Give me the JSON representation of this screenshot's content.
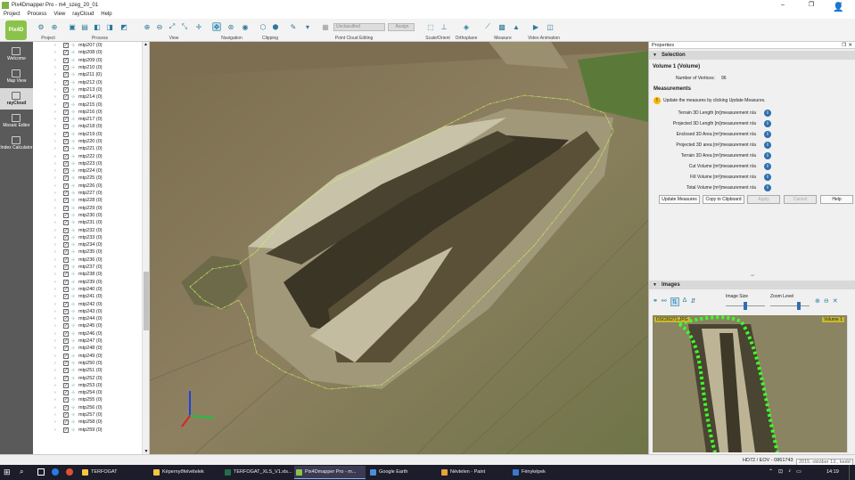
{
  "window": {
    "title": "Pix4Dmapper Pro - m4_szeg_20_01",
    "minimize": "–",
    "maximize": "❐",
    "close": "✕"
  },
  "menu": [
    "Project",
    "Process",
    "View",
    "rayCloud",
    "Help"
  ],
  "toolbar": {
    "groups": [
      "Project",
      "Process",
      "View",
      "Navigation",
      "Clipping",
      "Point Cloud Editing",
      "Scale/Orient",
      "Orthoplane",
      "Measure",
      "Video Animation"
    ],
    "class_combo": "Unclassified",
    "assign_label": "Assign"
  },
  "left_sidebar": {
    "logo": "Pix4D",
    "items": [
      {
        "label": "Welcome",
        "active": false
      },
      {
        "label": "Map View",
        "active": false
      },
      {
        "label": "rayCloud",
        "active": true
      },
      {
        "label": "Mosaic Editor",
        "active": false
      },
      {
        "label": "Index Calculator",
        "active": false
      }
    ]
  },
  "tree_items": [
    "mtp207 (0)",
    "mtp208 (0)",
    "mtp209 (0)",
    "mtp210 (0)",
    "mtp211 (0)",
    "mtp212 (0)",
    "mtp213 (0)",
    "mtp214 (0)",
    "mtp215 (0)",
    "mtp216 (0)",
    "mtp217 (0)",
    "mtp218 (0)",
    "mtp219 (0)",
    "mtp220 (0)",
    "mtp221 (0)",
    "mtp222 (0)",
    "mtp223 (0)",
    "mtp224 (0)",
    "mtp225 (0)",
    "mtp226 (0)",
    "mtp227 (0)",
    "mtp228 (0)",
    "mtp229 (0)",
    "mtp230 (0)",
    "mtp231 (0)",
    "mtp232 (0)",
    "mtp233 (0)",
    "mtp234 (0)",
    "mtp235 (0)",
    "mtp236 (0)",
    "mtp237 (0)",
    "mtp238 (0)",
    "mtp239 (0)",
    "mtp240 (0)",
    "mtp241 (0)",
    "mtp242 (0)",
    "mtp243 (0)",
    "mtp244 (0)",
    "mtp245 (0)",
    "mtp246 (0)",
    "mtp247 (0)",
    "mtp248 (0)",
    "mtp249 (0)",
    "mtp250 (0)",
    "mtp251 (0)",
    "mtp252 (0)",
    "mtp253 (0)",
    "mtp254 (0)",
    "mtp255 (0)",
    "mtp256 (0)",
    "mtp257 (0)",
    "mtp258 (0)",
    "mtp259 (0)"
  ],
  "properties": {
    "title": "Properties",
    "selection_header": "Selection",
    "volume_name": "Volume 1 (Volume)",
    "vertices_label": "Number of Vertices:",
    "vertices_value": "96",
    "measurements_header": "Measurements",
    "warning": "Update the measures by clicking Update Measures.",
    "measures": [
      {
        "label": "Terrain 3D Length [m]:",
        "value": "measurement n/a"
      },
      {
        "label": "Projected 3D Length [m]:",
        "value": "measurement n/a"
      },
      {
        "label": "Enclosed 3D Area [m²]:",
        "value": "measurement n/a"
      },
      {
        "label": "Projected 3D area [m²]:",
        "value": "measurement n/a"
      },
      {
        "label": "Terrain 3D Area [m²]:",
        "value": "measurement n/a"
      },
      {
        "label": "Cut Volume [m³]:",
        "value": "measurement n/a"
      },
      {
        "label": "Fill Volume [m³]:",
        "value": "measurement n/a"
      },
      {
        "label": "Total Volume [m³]:",
        "value": "measurement n/a"
      }
    ],
    "buttons": {
      "update": "Update Measures",
      "copy": "Copy to Clipboard",
      "apply": "Apply",
      "cancel": "Cancel",
      "help": "Help"
    }
  },
  "images": {
    "header": "Images",
    "image_size_label": "Image Size",
    "zoom_level_label": "Zoom Level",
    "image_size_level": 0.5,
    "zoom_level": 0.75,
    "thumbnail_name": "DSC06271.JPG",
    "overlay_label": "Volume 1"
  },
  "status": {
    "crs": "HD72 / EOV - 0861743",
    "tooltip": "2015. október 13., kedd"
  },
  "taskbar": {
    "items": [
      {
        "label": "TERFOGAT",
        "color": "#f5c542"
      },
      {
        "label": "Képernyőfelvételek",
        "color": "#f5c542"
      },
      {
        "label": "TERFOGAT_XLS_V1.xls...",
        "color": "#1e7145"
      },
      {
        "label": "Pix4Dmapper Pro - m...",
        "color": "#8bc34a",
        "active": true
      },
      {
        "label": "Google Earth",
        "color": "#4a90d9"
      },
      {
        "label": "Névtelen - Paint",
        "color": "#e6a23c"
      },
      {
        "label": "Fényképek",
        "color": "#3a78d0"
      }
    ],
    "clock": "14:19"
  }
}
